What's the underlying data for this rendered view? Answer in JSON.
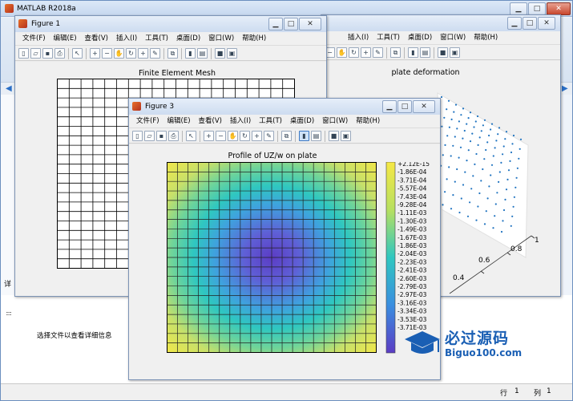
{
  "app": {
    "title": "MATLAB R2018a"
  },
  "main_window": {
    "detail_hint": "选择文件以查看详细信息",
    "left_label": "详",
    "status_row_label": "行",
    "status_row_value": "1",
    "status_col_label": "列",
    "status_col_value": "1"
  },
  "menus": [
    "文件(F)",
    "编辑(E)",
    "查看(V)",
    "插入(I)",
    "工具(T)",
    "桌面(D)",
    "窗口(W)",
    "帮助(H)"
  ],
  "figure1": {
    "title": "Figure 1",
    "plot_title": "Finite Element Mesh"
  },
  "figure2": {
    "plot_title": "plate deformation",
    "ticks": [
      "1",
      "0.8",
      "0.6",
      "0.4"
    ]
  },
  "figure3": {
    "title": "Figure 3",
    "plot_title": "Profile of UZ/w on plate",
    "colorbar_labels": [
      "+2.12E-15",
      "-1.86E-04",
      "-3.71E-04",
      "-5.57E-04",
      "-7.43E-04",
      "-9.28E-04",
      "-1.11E-03",
      "-1.30E-03",
      "-1.49E-03",
      "-1.67E-03",
      "-1.86E-03",
      "-2.04E-03",
      "-2.23E-03",
      "-2.41E-03",
      "-2.60E-03",
      "-2.79E-03",
      "-2.97E-03",
      "-3.16E-03",
      "-3.34E-03",
      "-3.53E-03",
      "-3.71E-03"
    ]
  },
  "watermark": {
    "brand": "必过源码",
    "site": "Biguo100.com"
  },
  "colors": {
    "accent": "#2a6fc7",
    "colormap_high": "#f6e845",
    "colormap_mid": "#2fc7c0",
    "colormap_low": "#5b3cc4"
  }
}
